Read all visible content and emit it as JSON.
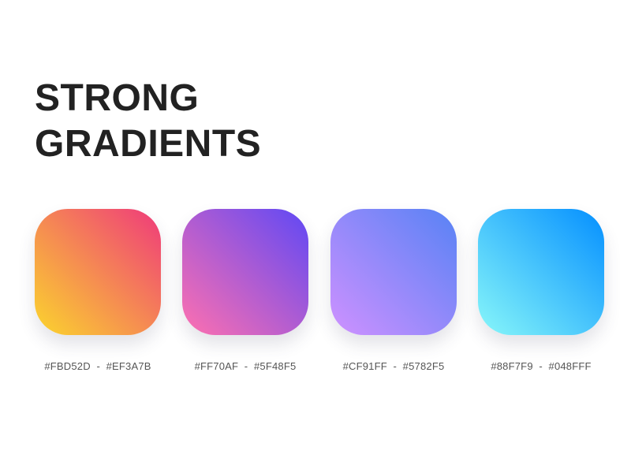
{
  "title": {
    "line1": "STRONG",
    "line2": "GRADIENTS"
  },
  "gradients": [
    {
      "from": "#FBD52D",
      "to": "#EF3A7B",
      "label": "#FBD52D  -  #EF3A7B"
    },
    {
      "from": "#FF70AF",
      "to": "#5F48F5",
      "label": "#FF70AF  -  #5F48F5"
    },
    {
      "from": "#CF91FF",
      "to": "#5782F5",
      "label": "#CF91FF  -  #5782F5"
    },
    {
      "from": "#88F7F9",
      "to": "#048FFF",
      "label": "#88F7F9  -  #048FFF"
    }
  ]
}
